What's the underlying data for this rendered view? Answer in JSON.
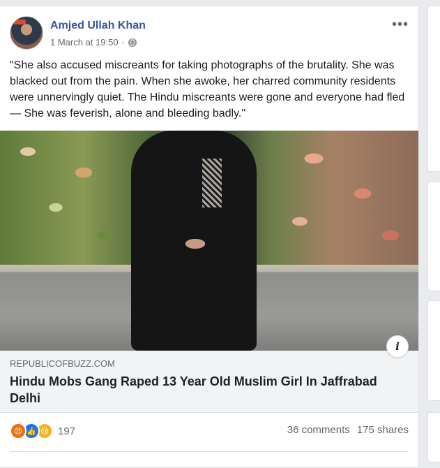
{
  "post": {
    "author": "Amjed Ullah Khan",
    "timestamp": "1 March at 19:50",
    "separator": "·",
    "more_label": "•••",
    "text": "\"She also accused miscreants for taking photographs of the brutality. She was blacked out from the pain. When she awoke, her charred community residents were unnervingly quiet. The Hindu miscreants were gone and everyone had fled — She was feverish, alone and bleeding badly.\""
  },
  "link": {
    "domain": "REPUBLICOFBUZZ.COM",
    "headline": "Hindu Mobs Gang Raped 13 Year Old Muslim Girl In Jaffrabad Delhi",
    "info_label": "i"
  },
  "stats": {
    "reaction_icons": [
      "angry-icon",
      "like-icon",
      "sad-icon"
    ],
    "reactions_count": "197",
    "comments": "36 comments",
    "shares": "175 shares"
  },
  "colors": {
    "author": "#365899",
    "background": "#e9ebee",
    "link_box": "#f2f3f5"
  }
}
